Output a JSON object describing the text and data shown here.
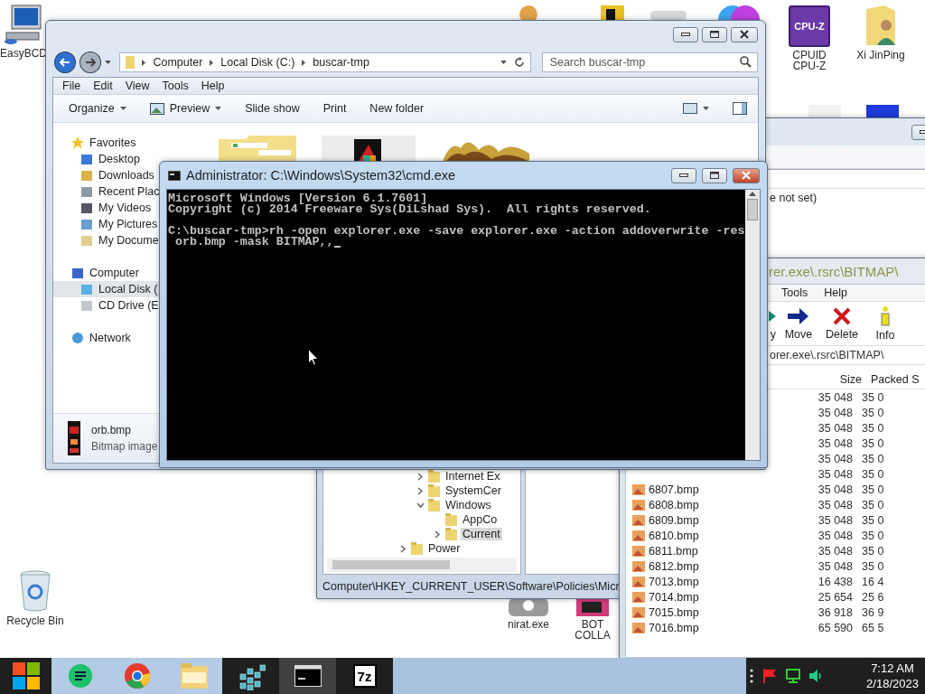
{
  "desktop_icons": [
    {
      "kind": "monitor",
      "label": "EasyBCD"
    },
    {
      "kind": "cpuz",
      "badge": "CPU-Z",
      "label": "CPUID CPU-Z"
    },
    {
      "kind": "user-folder",
      "label": "Xi JinPing"
    },
    {
      "kind": "recycle",
      "label": "Recycle Bin"
    },
    {
      "kind": "nirat",
      "label": "nirat.exe"
    },
    {
      "kind": "bot",
      "label": "BOT COLLA"
    },
    {
      "kind": "person"
    },
    {
      "kind": "yellow"
    },
    {
      "kind": "grey"
    },
    {
      "kind": "colorful"
    },
    {
      "kind": "white"
    },
    {
      "kind": "blue"
    }
  ],
  "regedit": {
    "value_text": "e not set)",
    "tree": [
      {
        "children": [
          {
            "label": "Internet Ex",
            "expanded": false,
            "selected": false
          },
          {
            "label": "SystemCer",
            "expanded": false,
            "selected": false
          },
          {
            "label": "Windows",
            "expanded": true,
            "selected": false,
            "children": [
              {
                "label": "AppCo",
                "selected": false
              },
              {
                "label": "Current",
                "expanded": false,
                "selected": true
              }
            ]
          }
        ]
      },
      {
        "label": "Power",
        "expanded": false,
        "selected": false
      }
    ],
    "status": "Computer\\HKEY_CURRENT_USER\\Software\\Policies\\Micr"
  },
  "sevenzip": {
    "title": "rer.exe\\.rsrc\\BITMAP\\",
    "menu": [
      "Tools",
      "Help"
    ],
    "toolbar": [
      {
        "kind": "copy",
        "label": "y"
      },
      {
        "kind": "move",
        "label": "Move"
      },
      {
        "kind": "delete",
        "label": "Delete"
      },
      {
        "kind": "info",
        "label": "Info"
      }
    ],
    "path": "orer.exe\\.rsrc\\BITMAP\\",
    "columns": [
      "Size",
      "Packed S"
    ],
    "rows": [
      {
        "size": "35 048",
        "packed": "35 0"
      },
      {
        "size": "35 048",
        "packed": "35 0"
      },
      {
        "size": "35 048",
        "packed": "35 0"
      },
      {
        "size": "35 048",
        "packed": "35 0"
      },
      {
        "size": "35 048",
        "packed": "35 0"
      },
      {
        "size": "35 048",
        "packed": "35 0"
      },
      {
        "name": "6807.bmp",
        "size": "35 048",
        "packed": "35 0"
      },
      {
        "name": "6808.bmp",
        "size": "35 048",
        "packed": "35 0"
      },
      {
        "name": "6809.bmp",
        "size": "35 048",
        "packed": "35 0"
      },
      {
        "name": "6810.bmp",
        "size": "35 048",
        "packed": "35 0"
      },
      {
        "name": "6811.bmp",
        "size": "35 048",
        "packed": "35 0"
      },
      {
        "name": "6812.bmp",
        "size": "35 048",
        "packed": "35 0"
      },
      {
        "name": "7013.bmp",
        "size": "16 438",
        "packed": "16 4"
      },
      {
        "name": "7014.bmp",
        "size": "25 654",
        "packed": "25 6"
      },
      {
        "name": "7015.bmp",
        "size": "36 918",
        "packed": "36 9"
      },
      {
        "name": "7016.bmp",
        "size": "65 590",
        "packed": "65 5"
      }
    ]
  },
  "explorer": {
    "breadcrumb": [
      "Computer",
      "Local Disk (C:)",
      "buscar-tmp"
    ],
    "search": {
      "placeholder": "Search buscar-tmp"
    },
    "menu": [
      "File",
      "Edit",
      "View",
      "Tools",
      "Help"
    ],
    "toolbar": [
      {
        "label": "Organize",
        "dropdown": true
      },
      {
        "label": "Preview",
        "dropdown": true,
        "kind": "preview"
      },
      {
        "label": "Slide show",
        "dropdown": false
      },
      {
        "label": "Print",
        "dropdown": false
      },
      {
        "label": "New folder",
        "dropdown": false
      }
    ],
    "nav": [
      {
        "label": "Favorites",
        "kind": "favorites",
        "selected": false,
        "children": [
          {
            "label": "Desktop",
            "kind": "desktop",
            "selected": false
          },
          {
            "label": "Downloads",
            "kind": "downloads",
            "selected": false
          },
          {
            "label": "Recent Plac",
            "kind": "recent",
            "selected": false
          },
          {
            "label": "My Videos",
            "kind": "videos",
            "selected": false
          },
          {
            "label": "My Pictures",
            "kind": "pictures",
            "selected": false
          },
          {
            "label": "My Docume",
            "kind": "documents",
            "selected": false
          }
        ]
      },
      {
        "label": "Computer",
        "kind": "computer",
        "selected": false,
        "children": [
          {
            "label": "Local Disk (",
            "kind": "disk",
            "selected": true
          },
          {
            "label": "CD Drive (E",
            "kind": "cd",
            "selected": false
          }
        ]
      },
      {
        "label": "Network",
        "kind": "network",
        "selected": false
      }
    ],
    "thumbnails": [
      {
        "kind": "folder"
      },
      {
        "kind": "picture"
      },
      {
        "kind": "picture"
      }
    ],
    "details": {
      "name": "orb.bmp",
      "type": "Bitmap image"
    }
  },
  "cmd": {
    "title": "Administrator: C:\\Windows\\System32\\cmd.exe",
    "lines": [
      {
        "text": "Microsoft Windows [Version 6.1.7601]"
      },
      {
        "text": "Copyright (c) 2014 Freeware Sys(DiLshad Sys).  All rights reserved."
      },
      {
        "text": "C:\\buscar-tmp>rh -open explorer.exe -save explorer.exe -action addoverwrite -res",
        "blank_before": true
      },
      {
        "text": " orb.bmp -mask BITMAP,,"
      }
    ]
  },
  "taskbar": {
    "pinned": [
      {
        "kind": "chat"
      },
      {
        "kind": "chrome"
      },
      {
        "kind": "folder"
      }
    ],
    "apps": [
      {
        "kind": "regedit",
        "selected": false
      },
      {
        "kind": "cmd",
        "selected": true
      },
      {
        "kind": "sevenzip",
        "label": "7z",
        "selected": false
      }
    ],
    "time": "7:12 AM",
    "date": "2/18/2023"
  }
}
